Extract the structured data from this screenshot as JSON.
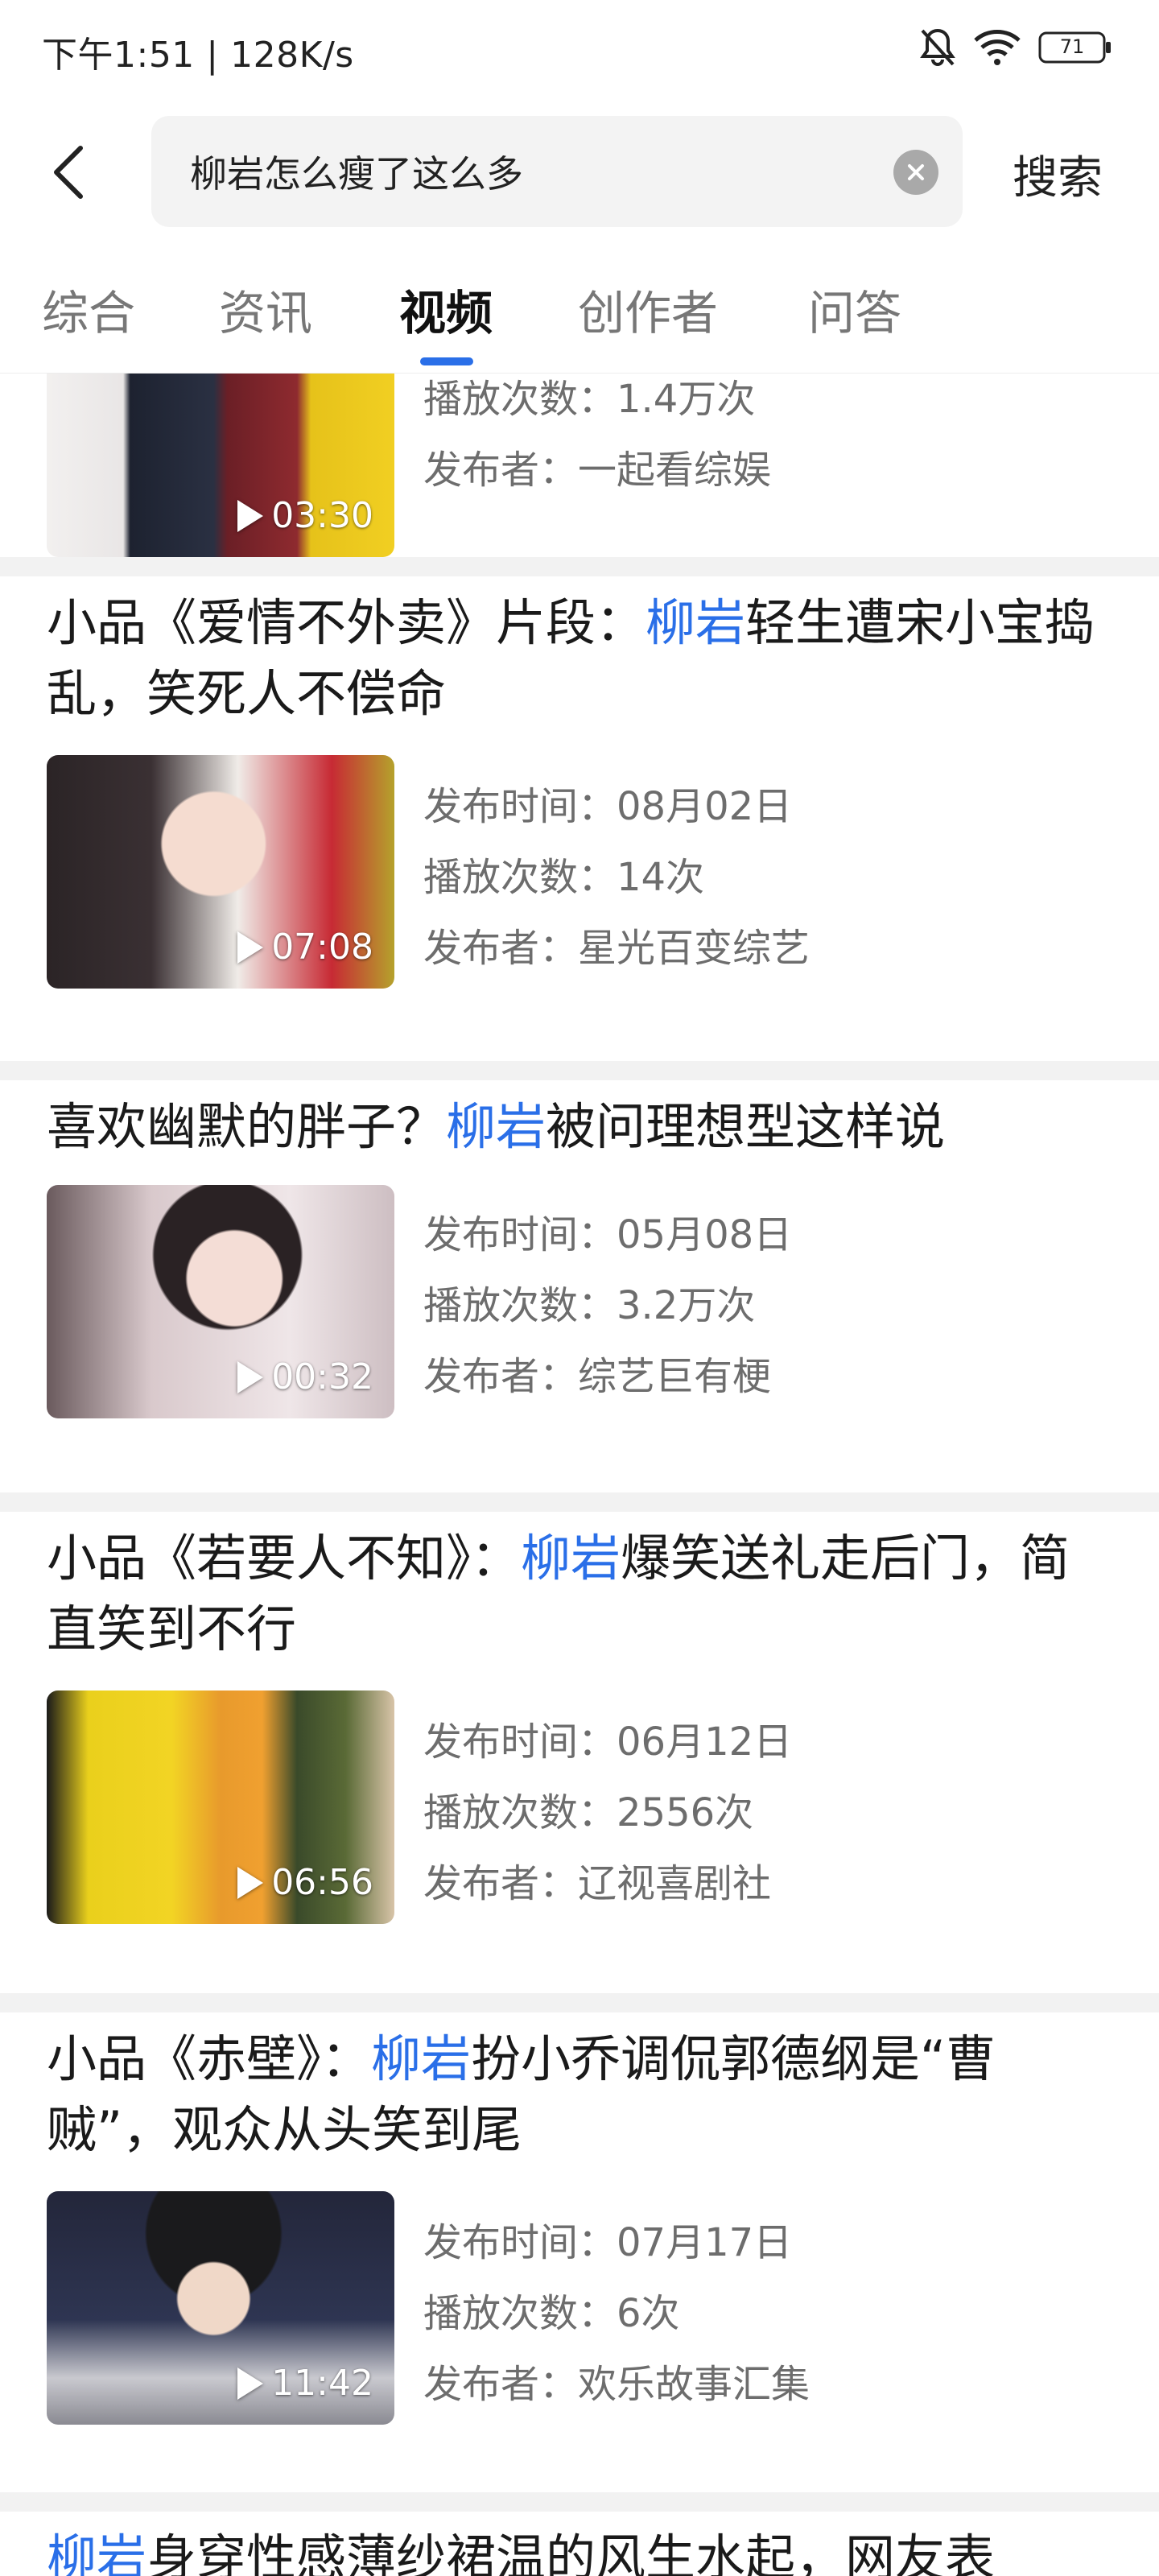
{
  "status_bar": {
    "time_speed": "下午1:51 | 128K/s",
    "battery": "71"
  },
  "search": {
    "query": "柳岩怎么瘦了这么多",
    "submit_label": "搜索"
  },
  "tabs": [
    {
      "label": "综合",
      "active": false
    },
    {
      "label": "资讯",
      "active": false
    },
    {
      "label": "视频",
      "active": true
    },
    {
      "label": "创作者",
      "active": false
    },
    {
      "label": "问答",
      "active": false
    }
  ],
  "accent_color": "#2a6fe8",
  "results": [
    {
      "duration": "03:30",
      "plays": "播放次数：1.4万次",
      "publisher": "发布者：一起看综娱"
    },
    {
      "title_pre": "小品《爱情不外卖》片段：",
      "title_hl": "柳岩",
      "title_post": "轻生遭宋小宝捣乱，笑死人不偿命",
      "published": "发布时间：08月02日",
      "plays": "播放次数：14次",
      "publisher": "发布者：星光百变综艺",
      "duration": "07:08"
    },
    {
      "title_pre": "喜欢幽默的胖子？",
      "title_hl": "柳岩",
      "title_post": "被问理想型这样说",
      "published": "发布时间：05月08日",
      "plays": "播放次数：3.2万次",
      "publisher": "发布者：综艺巨有梗",
      "duration": "00:32"
    },
    {
      "title_pre": "小品《若要人不知》：",
      "title_hl": "柳岩",
      "title_post": "爆笑送礼走后门，简直笑到不行",
      "published": "发布时间：06月12日",
      "plays": "播放次数：2556次",
      "publisher": "发布者：辽视喜剧社",
      "duration": "06:56"
    },
    {
      "title_pre": "小品《赤壁》：",
      "title_hl": "柳岩",
      "title_post": "扮小乔调侃郭德纲是“曹贼”，观众从头笑到尾",
      "published": "发布时间：07月17日",
      "plays": "播放次数：6次",
      "publisher": "发布者：欢乐故事汇集",
      "duration": "11:42"
    },
    {
      "title_hl": "柳岩",
      "title_post": "身穿性感薄纱裙温的风生水起，网友表"
    }
  ]
}
